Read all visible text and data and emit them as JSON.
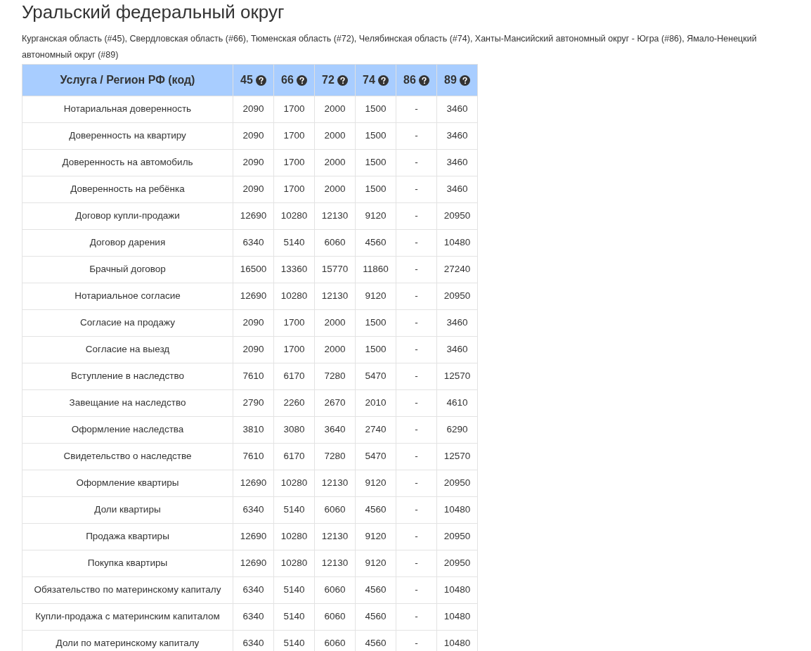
{
  "title": "Уральский федеральный округ",
  "regions_text": "Курганская область (#45), Свердловская область (#66), Тюменская область (#72), Челябинская область (#74), Ханты-Мансийский автономный округ - Югра (#86), Ямало-Ненецкий автономный округ (#89)",
  "table": {
    "columns": [
      {
        "label": "Услуга / Регион РФ (код)",
        "help_icon": false
      },
      {
        "label": "45",
        "help_icon": true
      },
      {
        "label": "66",
        "help_icon": true
      },
      {
        "label": "72",
        "help_icon": true
      },
      {
        "label": "74",
        "help_icon": true
      },
      {
        "label": "86",
        "help_icon": true
      },
      {
        "label": "89",
        "help_icon": true
      }
    ],
    "rows": [
      [
        "Нотариальная доверенность",
        "2090",
        "1700",
        "2000",
        "1500",
        "-",
        "3460"
      ],
      [
        "Доверенность на квартиру",
        "2090",
        "1700",
        "2000",
        "1500",
        "-",
        "3460"
      ],
      [
        "Доверенность на автомобиль",
        "2090",
        "1700",
        "2000",
        "1500",
        "-",
        "3460"
      ],
      [
        "Доверенность на ребёнка",
        "2090",
        "1700",
        "2000",
        "1500",
        "-",
        "3460"
      ],
      [
        "Договор купли-продажи",
        "12690",
        "10280",
        "12130",
        "9120",
        "-",
        "20950"
      ],
      [
        "Договор дарения",
        "6340",
        "5140",
        "6060",
        "4560",
        "-",
        "10480"
      ],
      [
        "Брачный договор",
        "16500",
        "13360",
        "15770",
        "11860",
        "-",
        "27240"
      ],
      [
        "Нотариальное согласие",
        "12690",
        "10280",
        "12130",
        "9120",
        "-",
        "20950"
      ],
      [
        "Согласие на продажу",
        "2090",
        "1700",
        "2000",
        "1500",
        "-",
        "3460"
      ],
      [
        "Согласие на выезд",
        "2090",
        "1700",
        "2000",
        "1500",
        "-",
        "3460"
      ],
      [
        "Вступление в наследство",
        "7610",
        "6170",
        "7280",
        "5470",
        "-",
        "12570"
      ],
      [
        "Завещание на наследство",
        "2790",
        "2260",
        "2670",
        "2010",
        "-",
        "4610"
      ],
      [
        "Оформление наследства",
        "3810",
        "3080",
        "3640",
        "2740",
        "-",
        "6290"
      ],
      [
        "Свидетельство о наследстве",
        "7610",
        "6170",
        "7280",
        "5470",
        "-",
        "12570"
      ],
      [
        "Оформление квартиры",
        "12690",
        "10280",
        "12130",
        "9120",
        "-",
        "20950"
      ],
      [
        "Доли квартиры",
        "6340",
        "5140",
        "6060",
        "4560",
        "-",
        "10480"
      ],
      [
        "Продажа квартиры",
        "12690",
        "10280",
        "12130",
        "9120",
        "-",
        "20950"
      ],
      [
        "Покупка квартиры",
        "12690",
        "10280",
        "12130",
        "9120",
        "-",
        "20950"
      ],
      [
        "Обязательство по материнскому капиталу",
        "6340",
        "5140",
        "6060",
        "4560",
        "-",
        "10480"
      ],
      [
        "Купли-продажа с материнским капиталом",
        "6340",
        "5140",
        "6060",
        "4560",
        "-",
        "10480"
      ],
      [
        "Доли по материнскому капиталу",
        "6340",
        "5140",
        "6060",
        "4560",
        "-",
        "10480"
      ]
    ]
  }
}
